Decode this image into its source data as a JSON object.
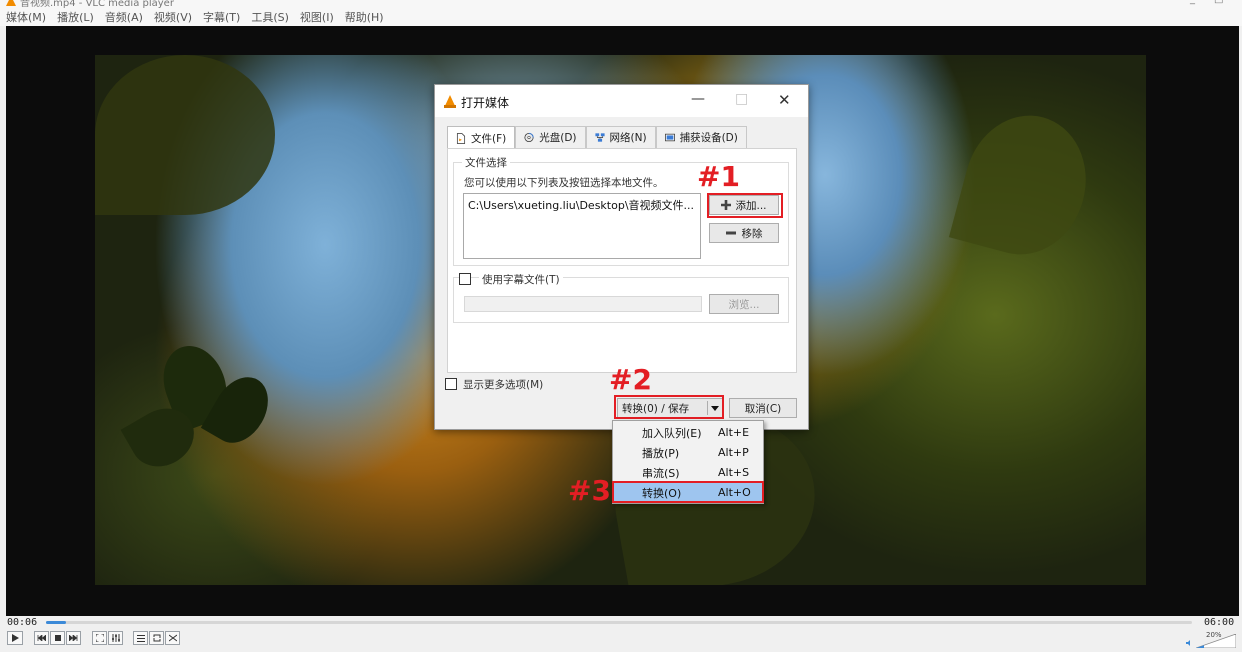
{
  "window": {
    "title": "音视频.mp4 - VLC media player",
    "minimize_glyph": "_",
    "maximize_glyph": "□"
  },
  "menubar": {
    "items": [
      "媒体(M)",
      "播放(L)",
      "音频(A)",
      "视频(V)",
      "字幕(T)",
      "工具(S)",
      "视图(I)",
      "帮助(H)"
    ]
  },
  "dialog": {
    "title": "打开媒体",
    "icon": "vlc-cone-icon",
    "min_glyph": "—",
    "max_glyph": "□",
    "close_glyph": "✕",
    "tabs": [
      {
        "label": "文件(F)",
        "icon": "file-icon",
        "active": true
      },
      {
        "label": "光盘(D)",
        "icon": "disc-icon",
        "active": false
      },
      {
        "label": "网络(N)",
        "icon": "network-icon",
        "active": false
      },
      {
        "label": "捕获设备(D)",
        "icon": "capture-device-icon",
        "active": false
      }
    ],
    "file_group_label": "文件选择",
    "file_hint": "您可以使用以下列表及按钮选择本地文件。",
    "file_list": [
      "C:\\Users\\xueting.liu\\Desktop\\音视频文件..."
    ],
    "add_button": "添加...",
    "add_icon": "plus-icon",
    "remove_button": "移除",
    "remove_icon": "minus-icon",
    "subtitle_checkbox_label": "使用字幕文件(T)",
    "browse_button": "浏览...",
    "more_options_label": "显示更多选项(M)",
    "convert_save_button": "转换(0) / 保存",
    "cancel_button": "取消(C)"
  },
  "dropdown_menu": {
    "items": [
      {
        "label": "加入队列(E)",
        "accel": "Alt+E",
        "selected": false
      },
      {
        "label": "播放(P)",
        "accel": "Alt+P",
        "selected": false
      },
      {
        "label": "串流(S)",
        "accel": "Alt+S",
        "selected": false
      },
      {
        "label": "转换(O)",
        "accel": "Alt+O",
        "selected": true
      }
    ]
  },
  "annotations": {
    "marker1": "#1",
    "marker2": "#2",
    "marker3": "#3",
    "color": "#e31e24"
  },
  "player": {
    "elapsed": "00:06",
    "duration": "06:00",
    "progress_fraction": 0.017,
    "volume_label": "20%",
    "accent": "#3c8ad8"
  }
}
